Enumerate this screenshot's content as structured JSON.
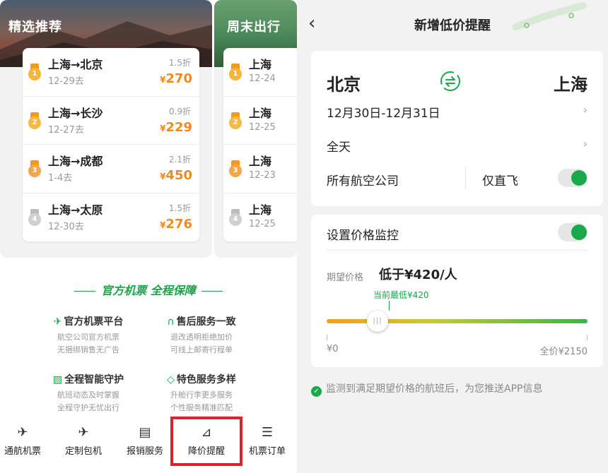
{
  "left": {
    "col1": {
      "banner_title": "精选推荐",
      "routes": [
        {
          "rank": "1",
          "name": "上海→北京",
          "date": "12-29去",
          "discount": "1.5折",
          "price": "270"
        },
        {
          "rank": "2",
          "name": "上海→长沙",
          "date": "12-27去",
          "discount": "0.9折",
          "price": "229"
        },
        {
          "rank": "3",
          "name": "上海→成都",
          "date": "1-4去",
          "discount": "2.1折",
          "price": "450"
        },
        {
          "rank": "4",
          "name": "上海→太原",
          "date": "12-30去",
          "discount": "1.5折",
          "price": "276"
        }
      ]
    },
    "col2": {
      "banner_title": "周末出行",
      "routes": [
        {
          "rank": "1",
          "name": "上海",
          "date": "12-24"
        },
        {
          "rank": "2",
          "name": "上海",
          "date": "12-25"
        },
        {
          "rank": "3",
          "name": "上海",
          "date": "12-23"
        },
        {
          "rank": "4",
          "name": "上海",
          "date": "12-25"
        }
      ]
    },
    "currency": "¥",
    "guarantee_title": "官方机票 全程保障",
    "features": [
      {
        "title": "官方机票平台",
        "desc1": "航空公司官方机票",
        "desc2": "无捆绑销售无广告",
        "icon": "plane-icon"
      },
      {
        "title": "售后服务一致",
        "desc1": "退改透明拒绝加价",
        "desc2": "可线上邮寄行程单",
        "icon": "headset-icon"
      },
      {
        "title": "全程智能守护",
        "desc1": "航班动态及时掌握",
        "desc2": "全程守护无忧出行",
        "icon": "chart-icon"
      },
      {
        "title": "特色服务多样",
        "desc1": "升舱行李更多服务",
        "desc2": "个性服务精准匹配",
        "icon": "diamond-icon"
      }
    ],
    "tabs": [
      {
        "label": "通航机票",
        "icon": "plane-icon"
      },
      {
        "label": "定制包机",
        "icon": "charter-plane-icon"
      },
      {
        "label": "报销服务",
        "icon": "receipt-icon"
      },
      {
        "label": "降价提醒",
        "icon": "price-alert-icon"
      },
      {
        "label": "机票订单",
        "icon": "order-icon"
      }
    ]
  },
  "right": {
    "nav_title": "新增低价提醒",
    "from_city": "北京",
    "to_city": "上海",
    "date_range": "12月30日-12月31日",
    "time_range": "全天",
    "airline": "所有航空公司",
    "direct_only_label": "仅直飞",
    "direct_only": true,
    "monitor_label": "设置价格监控",
    "monitor_on": true,
    "expected_label": "期望价格",
    "expected_value": "低于¥420/人",
    "current_low_label": "当前最低¥420",
    "slider_min": "¥0",
    "slider_max": "全价¥2150",
    "slider_value": 420,
    "slider_max_value": 2150,
    "notice": "监测到满足期望价格的航班后，为您推送APP信息",
    "colors": {
      "accent": "#19a94c",
      "price": "#f08a1c",
      "highlight": "#e0202a"
    }
  }
}
